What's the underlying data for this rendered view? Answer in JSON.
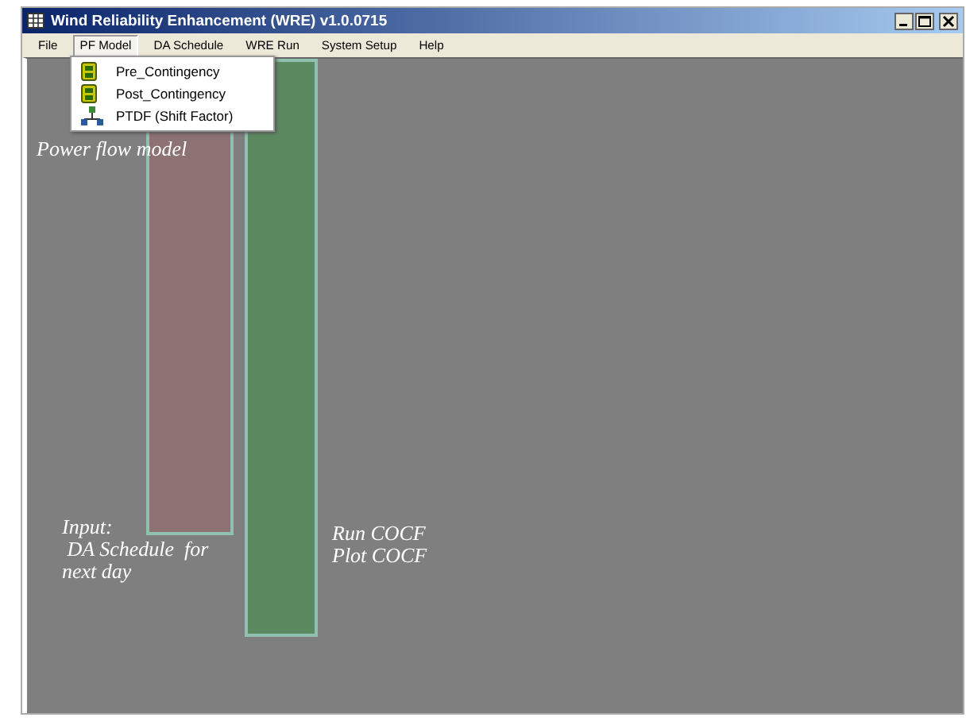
{
  "window": {
    "title": "Wind Reliability Enhancement (WRE) v1.0.0715"
  },
  "menu_bar": [
    {
      "label": "File",
      "selected": false
    },
    {
      "label": "PF Model",
      "selected": true
    },
    {
      "label": "DA Schedule",
      "selected": false
    },
    {
      "label": "WRE Run",
      "selected": false
    },
    {
      "label": "System Setup",
      "selected": false
    },
    {
      "label": "Help",
      "selected": false
    }
  ],
  "dropdown": [
    {
      "label": "Pre_Contingency",
      "kind": "device"
    },
    {
      "label": "Post_Contingency",
      "kind": "device"
    },
    {
      "label": "PTDF (Shift Factor)",
      "kind": "network"
    }
  ],
  "highlights": [
    {
      "color": "#8c7272"
    },
    {
      "color": "#5c8a60"
    }
  ],
  "annotations": [
    "Power flow model",
    "Input:\n DA Schedule  for\nnext day",
    "Run COCF\nPlot COCF"
  ]
}
